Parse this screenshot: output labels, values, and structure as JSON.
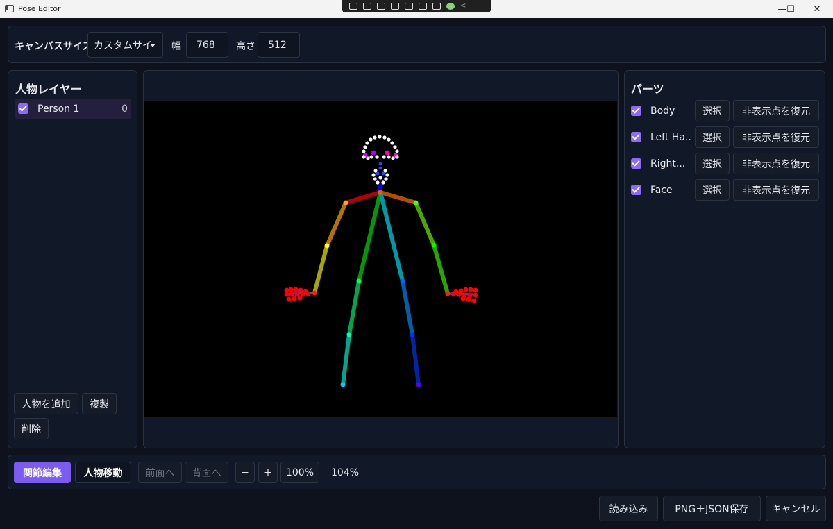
{
  "window": {
    "title": "Pose Editor",
    "minimize": "—",
    "maximize": "☐",
    "close": "✕"
  },
  "toolbar": {
    "canvas_size_label": "キャンバスサイズ",
    "preset_value": "カスタムサイ",
    "width_label": "幅",
    "width_value": "768",
    "height_label": "高さ",
    "height_value": "512"
  },
  "layers": {
    "heading": "人物レイヤー",
    "items": [
      {
        "name": "Person 1",
        "index": "0",
        "checked": true
      }
    ],
    "add_button": "人物を追加",
    "duplicate_button": "複製",
    "delete_button": "削除"
  },
  "parts": {
    "heading": "パーツ",
    "items": [
      {
        "name": "Body",
        "select": "選択",
        "restore": "非表示点を復元"
      },
      {
        "name": "Left Ha..",
        "select": "選択",
        "restore": "非表示点を復元"
      },
      {
        "name": "Right...",
        "select": "選択",
        "restore": "非表示点を復元"
      },
      {
        "name": "Face",
        "select": "選択",
        "restore": "非表示点を復元"
      }
    ]
  },
  "bottom_bar": {
    "joint_edit": "関節編集",
    "move_person": "人物移動",
    "bring_forward": "前面へ",
    "send_backward": "背面へ",
    "zoom_out": "−",
    "zoom_in": "+",
    "zoom_reset": "100%",
    "zoom_level": "104%"
  },
  "footer": {
    "load": "読み込み",
    "save": "PNG＋JSON保存",
    "cancel": "キャンセル"
  },
  "colors": {
    "accent": "#7c5cf0",
    "background": "#0d121c",
    "panel": "#111827"
  }
}
